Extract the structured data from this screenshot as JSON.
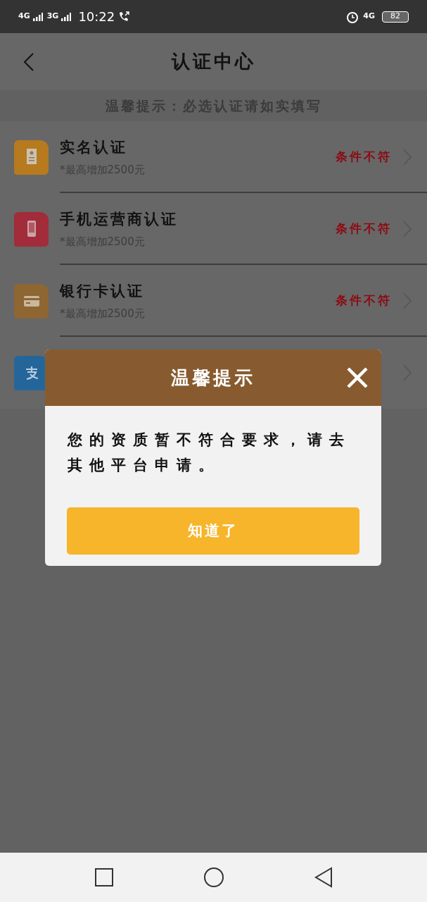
{
  "status_bar": {
    "signal_1": "4G",
    "signal_2": "3G",
    "time": "10:22",
    "network": "4G",
    "battery": "82"
  },
  "header": {
    "title": "认证中心"
  },
  "notice": "温馨提示：必选认证请如实填写",
  "items": [
    {
      "title": "实名认证",
      "subtitle": "*最高增加2500元",
      "status": "条件不符"
    },
    {
      "title": "手机运营商认证",
      "subtitle": "*最高增加2500元",
      "status": "条件不符"
    },
    {
      "title": "银行卡认证",
      "subtitle": "*最高增加2500元",
      "status": "条件不符"
    }
  ],
  "dialog": {
    "title": "温馨提示",
    "message": "您的资质暂不符合要求，请去其他平台申请。",
    "button": "知道了"
  }
}
